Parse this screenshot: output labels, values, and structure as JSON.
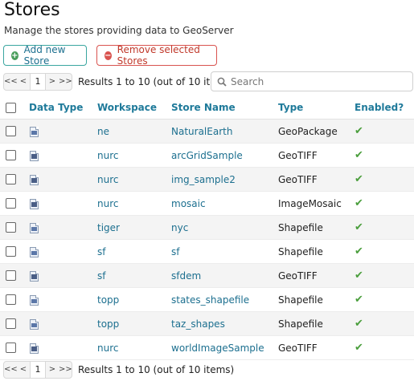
{
  "page": {
    "title": "Stores",
    "subtitle": "Manage the stores providing data to GeoServer"
  },
  "actions": {
    "add_label": "Add new Store",
    "remove_label": "Remove selected Stores"
  },
  "pager": {
    "first": "<<",
    "prev": "<",
    "current": "1",
    "next": ">",
    "last": ">>",
    "results": "Results 1 to 10 (out of 10 items)"
  },
  "search": {
    "placeholder": "Search",
    "value": ""
  },
  "table": {
    "headers": {
      "data_type": "Data Type",
      "workspace": "Workspace",
      "store_name": "Store Name",
      "type": "Type",
      "enabled": "Enabled?"
    },
    "rows": [
      {
        "workspace": "ne",
        "store_name": "NaturalEarth",
        "type": "GeoPackage",
        "data_icon": "vector-store-icon",
        "enabled": true
      },
      {
        "workspace": "nurc",
        "store_name": "arcGridSample",
        "type": "GeoTIFF",
        "data_icon": "raster-store-icon",
        "enabled": true
      },
      {
        "workspace": "nurc",
        "store_name": "img_sample2",
        "type": "GeoTIFF",
        "data_icon": "raster-store-icon",
        "enabled": true
      },
      {
        "workspace": "nurc",
        "store_name": "mosaic",
        "type": "ImageMosaic",
        "data_icon": "raster-store-icon",
        "enabled": true
      },
      {
        "workspace": "tiger",
        "store_name": "nyc",
        "type": "Shapefile",
        "data_icon": "vector-store-icon",
        "enabled": true
      },
      {
        "workspace": "sf",
        "store_name": "sf",
        "type": "Shapefile",
        "data_icon": "vector-store-icon",
        "enabled": true
      },
      {
        "workspace": "sf",
        "store_name": "sfdem",
        "type": "GeoTIFF",
        "data_icon": "raster-store-icon",
        "enabled": true
      },
      {
        "workspace": "topp",
        "store_name": "states_shapefile",
        "type": "Shapefile",
        "data_icon": "vector-store-icon",
        "enabled": true
      },
      {
        "workspace": "topp",
        "store_name": "taz_shapes",
        "type": "Shapefile",
        "data_icon": "vector-store-icon",
        "enabled": true
      },
      {
        "workspace": "nurc",
        "store_name": "worldImageSample",
        "type": "GeoTIFF",
        "data_icon": "raster-store-icon",
        "enabled": true
      }
    ]
  },
  "colors": {
    "link": "#1c6f8f",
    "header": "#1f7a9a",
    "add_border": "#3aa6a0",
    "remove_border": "#d9534f",
    "enabled_check": "#4a9e3c"
  }
}
